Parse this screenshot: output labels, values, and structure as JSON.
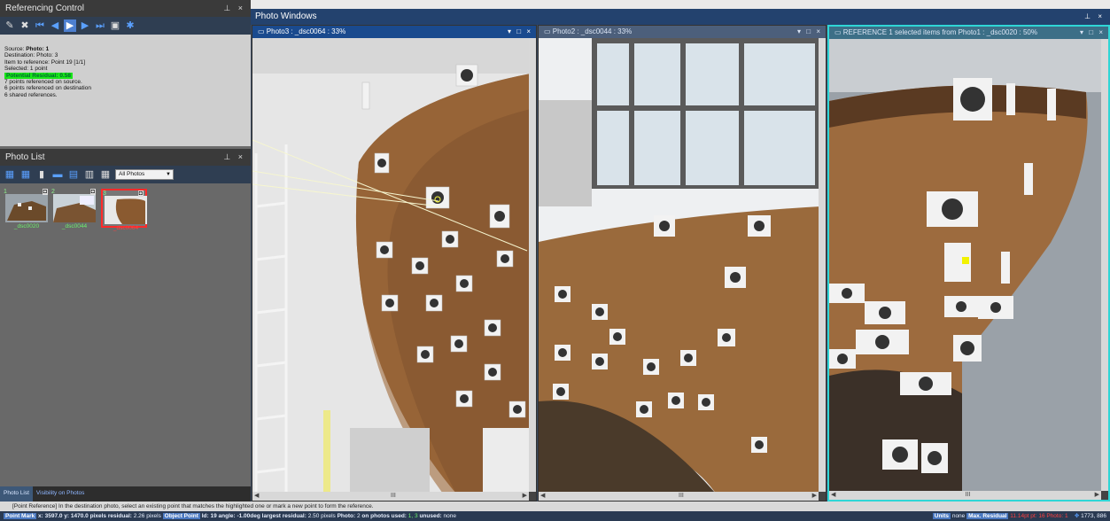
{
  "referencing_control": {
    "title": "Referencing Control",
    "pin": "\u0004 ×",
    "toolbar_icons": [
      "mark-icon",
      "remove-icon",
      "first-icon",
      "prev-icon",
      "play-icon",
      "next-icon",
      "last-icon",
      "frame-icon",
      "star-icon"
    ],
    "source_label": "Source:",
    "source_value": "Photo: 1",
    "destination": "Destination:   Photo: 3",
    "item": "Item to reference:  Point 19  [1/1]",
    "selected": "Selected: 1 point",
    "residual": "Potential Residual:  0.58",
    "line1": "7 points referenced on source.",
    "line2": "6 points referenced on destination",
    "line3": "6 shared references."
  },
  "photo_list": {
    "title": "Photo List",
    "filter": "All Photos",
    "thumbs": [
      {
        "num": "1",
        "caption": "_dsc0020"
      },
      {
        "num": "2",
        "caption": "_dsc0044"
      },
      {
        "num": "3",
        "caption": "_dsc0064"
      }
    ],
    "tabs": [
      "Photo List",
      "Visibility on Photos"
    ]
  },
  "photo_windows": {
    "title": "Photo Windows",
    "windows": [
      {
        "title": "Photo3 : _dsc0064 : 33%"
      },
      {
        "title": "Photo2 : _dsc0044 : 33%"
      },
      {
        "title": "REFERENCE 1 selected items from Photo1 : _dsc0020 : 50%"
      }
    ],
    "scroll_mid": "III"
  },
  "hint": "[Point Reference] In the destination photo, select an existing point that matches the highlighted one or mark a new point to form the reference.",
  "status": {
    "point_mark": "Point Mark",
    "point_mark_text": "x: 3597.0 y: 1470.0 pixels",
    "residual_label": "residual:",
    "residual_text": "2.26 pixels",
    "object_point": "Object Point",
    "object_text": "Id: 19 angle: -1.00deg",
    "largest_label": "largest residual:",
    "largest_text": "2.50 pixels",
    "photo_label": "Photo:",
    "photo_text": "2",
    "on_photos_label": "on photos used:",
    "on_photos_value": "1, 3",
    "unused_label": "unused:",
    "unused_text": "none",
    "units_tag": "Units",
    "units_value": "none",
    "max_residual_tag": "Max. Residual",
    "max_residual_text": "11.14pt pt: 16 Photo: 1",
    "coords": "1773, 886"
  },
  "colors": {
    "accent": "#23426e",
    "residual_green": "#19e619",
    "ref_border": "#2fd6d6",
    "selected_thumb": "#ff2a2a"
  }
}
